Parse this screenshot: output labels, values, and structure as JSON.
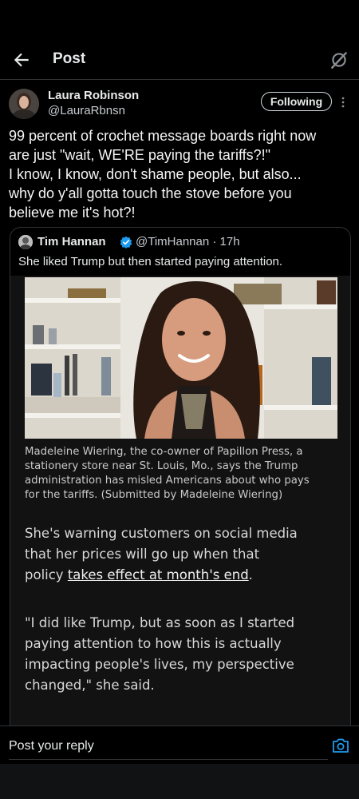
{
  "header": {
    "title": "Post",
    "back_icon": "arrow-left-icon",
    "grok_icon": "grok-icon"
  },
  "post": {
    "author_name": "Laura Robinson",
    "author_handle": "@LauraRbnsn",
    "follow_label": "Following",
    "text_lines": [
      "99 percent of crochet message boards right now",
      "are just \"wait, WE'RE paying the tariffs?!\"",
      "I know, I know, don't shame people, but also...",
      "why do y'all gotta touch the stove before you",
      "believe me it's hot?!"
    ]
  },
  "quote": {
    "author_name": "Tim Hannan",
    "author_handle": "@TimHannan · 17h",
    "text": "She liked Trump but then started paying attention.",
    "caption_lines": [
      "Madeleine Wiering, the co-owner of Papillon Press, a",
      "stationery store near St. Louis, Mo., says the Trump",
      "administration has misled Americans about who pays",
      "for the tariffs. (Submitted by Madeleine Wiering)"
    ],
    "para1_line1": "She's warning customers on social media",
    "para1_line2": "that her prices will go up when that",
    "para1_line3_prefix": "policy ",
    "para1_link": "takes effect at month's end",
    "para1_line3_suffix": ".",
    "para2_lines": [
      "\"I did like Trump, but as soon as I started",
      "paying attention to how this is actually",
      "impacting people's lives, my perspective",
      "changed,\" she said."
    ]
  },
  "reply": {
    "placeholder": "Post your reply",
    "camera_icon": "camera-icon"
  },
  "colors": {
    "background": "#000000",
    "text": "#e7e9ea",
    "secondary": "#c8ccd0",
    "divider": "#2f3336",
    "accent": "#1d9bf0"
  }
}
